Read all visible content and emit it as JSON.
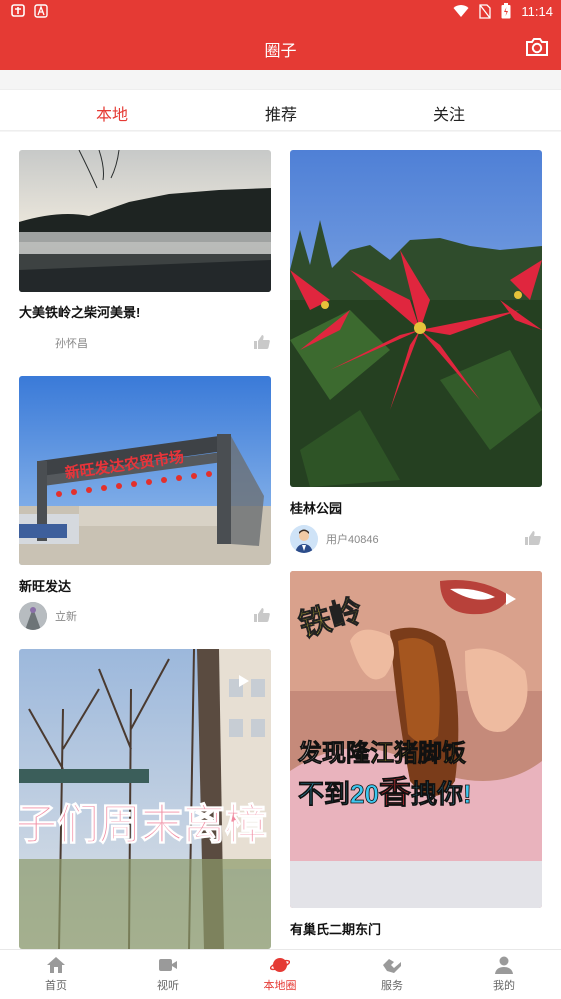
{
  "status_bar": {
    "time": "11:14",
    "icons": [
      "notification-app-icon",
      "app-a-icon",
      "wifi-icon",
      "no-sim-icon",
      "battery-icon"
    ]
  },
  "header": {
    "title": "圈子",
    "camera_icon": "camera-icon"
  },
  "tabs": [
    {
      "label": "本地",
      "active": true
    },
    {
      "label": "推荐",
      "active": false
    },
    {
      "label": "关注",
      "active": false
    }
  ],
  "posts": [
    {
      "title": "大美铁岭之柴河美景!",
      "author": "孙怀昌"
    },
    {
      "title": "桂林公园",
      "author": "用户40846"
    },
    {
      "title": "新旺发达",
      "author": "立新"
    },
    {
      "title": "有巢氏二期东门",
      "author": ""
    },
    {
      "title": "",
      "author": ""
    }
  ],
  "image_text": {
    "market_sign": "新旺发达农贸市场",
    "video_city": "铁岭",
    "video_line1_a": "发现",
    "video_line1_b": "隆江猪脚饭",
    "video_line2_a": "不到20",
    "video_line2_b": "香",
    "video_line2_c": "拽你!",
    "video3_overlay": "子们周末离樟"
  },
  "bottom_nav": [
    {
      "label": "首页",
      "icon": "home-icon",
      "active": false
    },
    {
      "label": "视听",
      "icon": "video-icon",
      "active": false
    },
    {
      "label": "本地圈",
      "icon": "planet-icon",
      "active": true
    },
    {
      "label": "服务",
      "icon": "service-icon",
      "active": false
    },
    {
      "label": "我的",
      "icon": "profile-icon",
      "active": false
    }
  ],
  "colors": {
    "brand_red": "#e53a34",
    "text": "#111111",
    "muted": "#888888"
  }
}
